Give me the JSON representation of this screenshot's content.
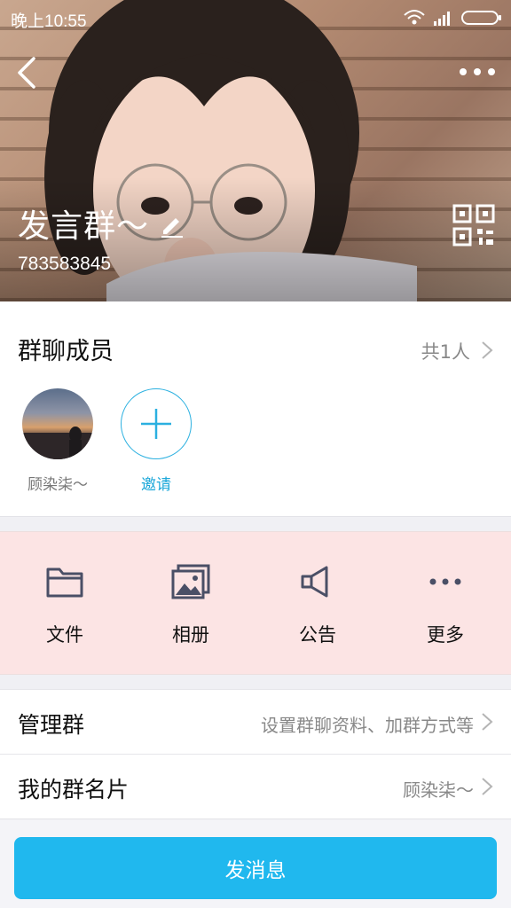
{
  "status_bar": {
    "time": "晚上10:55"
  },
  "header": {
    "group_name": "发言群～",
    "group_id": "783583845"
  },
  "members": {
    "title": "群聊成员",
    "count": "共1人",
    "items": [
      {
        "name": "顾染柒～"
      }
    ],
    "invite_label": "邀请"
  },
  "tools": [
    {
      "label": "文件",
      "icon": "folder-icon"
    },
    {
      "label": "相册",
      "icon": "album-icon"
    },
    {
      "label": "公告",
      "icon": "megaphone-icon"
    },
    {
      "label": "更多",
      "icon": "more-dots-icon"
    }
  ],
  "settings": {
    "manage": {
      "title": "管理群",
      "value": "设置群聊资料、加群方式等"
    },
    "card": {
      "title": "我的群名片",
      "value": "顾染柒～"
    }
  },
  "send_button": {
    "label": "发消息"
  },
  "colors": {
    "accent": "#20b8ee",
    "tools_bg": "#fce4e4",
    "invite": "#1aa7d9"
  }
}
